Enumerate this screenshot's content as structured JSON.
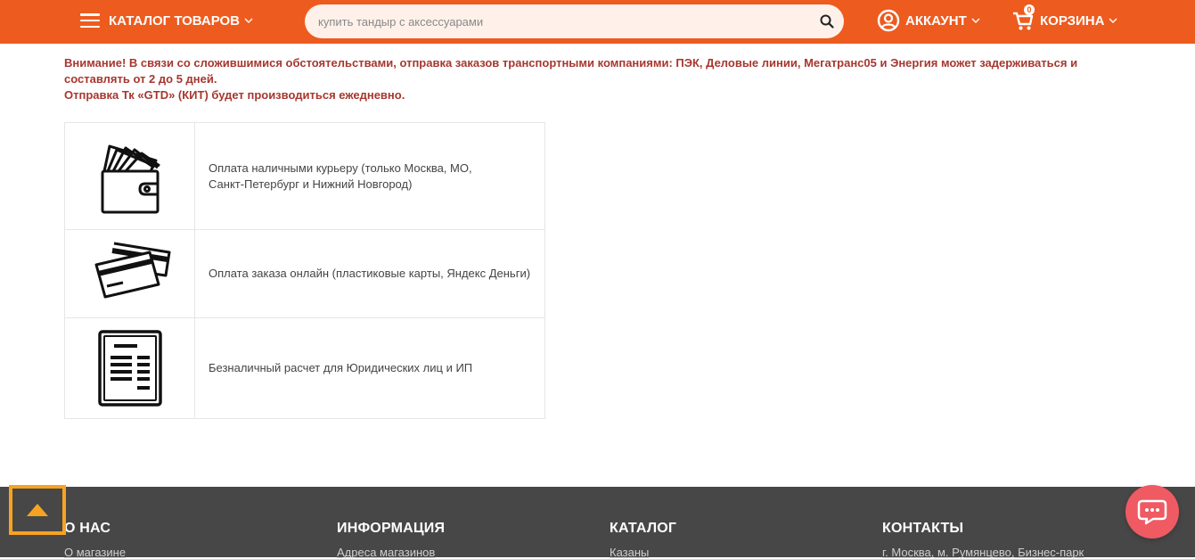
{
  "header": {
    "catalog_label": "КАТАЛОГ ТОВАРОВ",
    "search_placeholder": "купить тандыр с аксессуарами",
    "account_label": "АККАУНТ",
    "cart_label": "КОРЗИНА",
    "cart_count": "0"
  },
  "notice": {
    "line1": "Внимание! В связи со сложившимися обстоятельствами, отправка заказов транспортными компаниями: ПЭК, Деловые линии, Мегатранс05 и Энергия может задерживаться и составлять от 2 до 5 дней.",
    "line2": "Отправка Тк «GTD» (КИТ) будет производиться ежедневно."
  },
  "payment_methods": [
    {
      "icon": "wallet-icon",
      "text_line1": "Оплата наличными курьеру (только Москва, МО,",
      "text_line2": "Санкт-Петербург и Нижний Новгород)"
    },
    {
      "icon": "credit-cards-icon",
      "text_line1": "Оплата заказа онлайн (пластиковые карты, Яндекс Деньги)",
      "text_line2": ""
    },
    {
      "icon": "invoice-icon",
      "text_line1": "Безналичный расчет для Юридических лиц и ИП",
      "text_line2": ""
    }
  ],
  "footer": {
    "col1": {
      "title": "О НАС",
      "link": "О магазине"
    },
    "col2": {
      "title": "ИНФОРМАЦИЯ",
      "link": "Адреса магазинов"
    },
    "col3": {
      "title": "КАТАЛОГ",
      "link": "Казаны"
    },
    "col4": {
      "title": "КОНТАКТЫ",
      "link": "г. Москва, м. Румянцево, Бизнес-парк"
    }
  },
  "colors": {
    "brand_orange": "#ee5b1f",
    "notice_red": "#a6372f",
    "footer_bg": "#474747",
    "scroll_top_border": "#f7a321",
    "chat_button": "#ef5a63"
  }
}
